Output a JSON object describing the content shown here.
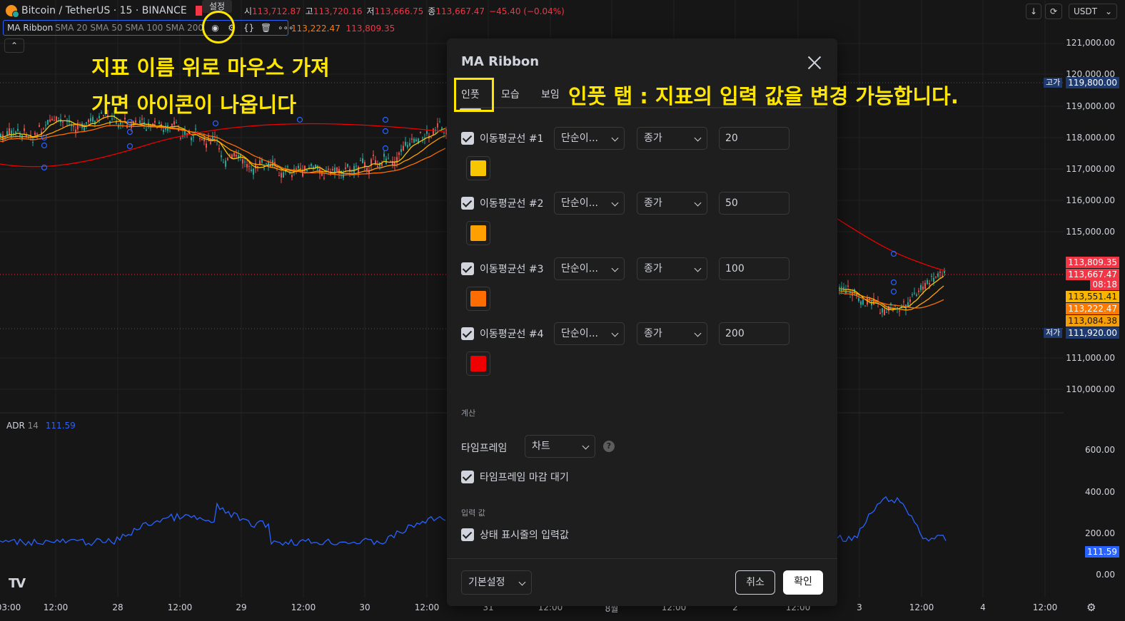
{
  "header": {
    "symbol": "Bitcoin / TetherUS · 15 · BINANCE",
    "tooltip": "설정",
    "ohlc": [
      {
        "k": "시",
        "v": "113,712.87"
      },
      {
        "k": "고",
        "v": "113,720.16"
      },
      {
        "k": "저",
        "v": "113,666.75"
      },
      {
        "k": "종",
        "v": "113,667.47"
      }
    ],
    "change": "−45.40 (−0.04%)",
    "currency": "USDT"
  },
  "indicator": {
    "name": "MA Ribbon",
    "args": "SMA 20 SMA 50 SMA 100 SMA 200",
    "value1": "113,222.47",
    "value2": "113,809.35",
    "more": "∘∘∘"
  },
  "annotations": {
    "line1": "지표 이름 위로 마우스 가져",
    "line2": "가면 아이콘이 나옵니다",
    "tab_note": "인풋 탭 : 지표의 입력 값을 변경 가능합니다."
  },
  "price_axis": {
    "ticks": [
      "121,000.00",
      "120,000.00",
      "119,000.00",
      "118,000.00",
      "117,000.00",
      "116,000.00",
      "115,000.00",
      "114,000.00",
      "111,000.00",
      "110,000.00"
    ],
    "high_label": "고가",
    "high_value": "119,800.00",
    "low_label": "저가",
    "low_value": "111,920.00",
    "tags": [
      {
        "text": "113,809.35",
        "color": "#f23645"
      },
      {
        "text": "113,667.47",
        "color": "#f23645"
      },
      {
        "text": "08:18",
        "color": "#f23645"
      },
      {
        "text": "113,551.41",
        "color": "#f7b500"
      },
      {
        "text": "113,222.47",
        "color": "#ff7a00"
      },
      {
        "text": "113,084.38",
        "color": "#f59e0b"
      }
    ],
    "adr_ticks": [
      "600.00",
      "400.00",
      "200.00",
      "0.00"
    ],
    "adr_tag": "111.59"
  },
  "adr": {
    "name": "ADR",
    "len": "14",
    "value": "111.59"
  },
  "time_axis": [
    "03:00",
    "12:00",
    "28",
    "12:00",
    "29",
    "12:00",
    "30",
    "12:00",
    "31",
    "12:00",
    "8월",
    "12:00",
    "2",
    "12:00",
    "3",
    "12:00",
    "4",
    "12:00"
  ],
  "dialog": {
    "title": "MA Ribbon",
    "tabs": [
      "인풋",
      "모습",
      "보임"
    ],
    "mas": [
      {
        "label": "이동평균선 #1",
        "type": "단순이...",
        "source": "종가",
        "length": "20",
        "color": "#f7c600"
      },
      {
        "label": "이동평균선 #2",
        "type": "단순이...",
        "source": "종가",
        "length": "50",
        "color": "#ff9f00"
      },
      {
        "label": "이동평균선 #3",
        "type": "단순이...",
        "source": "종가",
        "length": "100",
        "color": "#ff6d00"
      },
      {
        "label": "이동평균선 #4",
        "type": "단순이...",
        "source": "종가",
        "length": "200",
        "color": "#f00000"
      }
    ],
    "calc_section": "계산",
    "timeframe_label": "타임프레임",
    "timeframe_value": "차트",
    "help": "?",
    "wait_close": "타임프레임 마감 대기",
    "inputs_section": "입력 값",
    "status_inputs": "상태 표시줄의 입력값",
    "defaults": "기본설정",
    "cancel": "취소",
    "ok": "확인"
  }
}
